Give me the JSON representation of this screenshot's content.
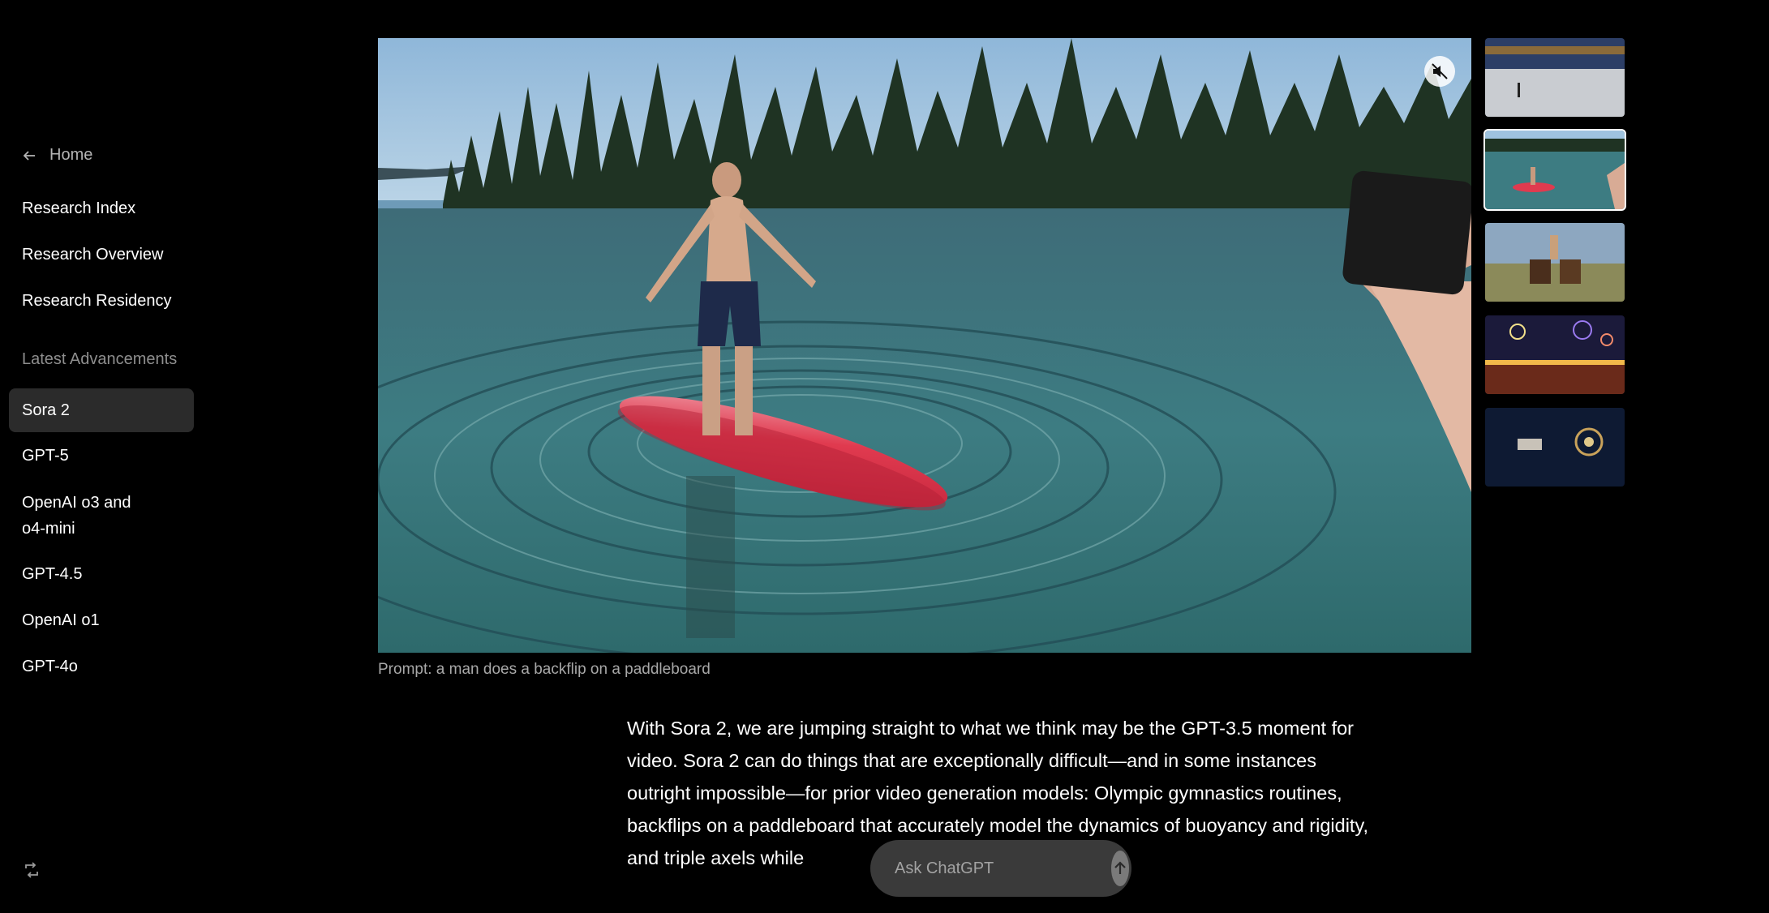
{
  "sidebar": {
    "home_label": "Home",
    "top_items": [
      {
        "label": "Research Index"
      },
      {
        "label": "Research Overview"
      },
      {
        "label": "Research Residency"
      }
    ],
    "section_label": "Latest Advancements",
    "section_items": [
      {
        "label": "Sora 2",
        "active": true
      },
      {
        "label": "GPT-5"
      },
      {
        "label": "OpenAI o3 and o4-mini"
      },
      {
        "label": "GPT-4.5"
      },
      {
        "label": "OpenAI o1"
      },
      {
        "label": "GPT-4o"
      }
    ],
    "footer_icon": "refresh-icon"
  },
  "video": {
    "caption": "Prompt: a man does a backflip on a paddleboard",
    "mute_icon": "muted-speaker-icon"
  },
  "thumbnails": [
    {
      "name": "ice-rink-skater"
    },
    {
      "name": "paddleboard-lake"
    },
    {
      "name": "horses-rider"
    },
    {
      "name": "fireworks-street"
    },
    {
      "name": "space-scene"
    }
  ],
  "article": {
    "paragraph": "With Sora 2, we are jumping straight to what we think may be the GPT-3.5 moment for video. Sora 2 can do things that are exceptionally difficult—and in some instances outright impossible—for prior video generation models: Olympic gymnastics routines, backflips on a paddleboard that accurately model the dynamics of buoyancy and rigidity, and triple axels while"
  },
  "ask_bar": {
    "placeholder": "Ask ChatGPT",
    "send_icon": "arrow-up-icon"
  },
  "colors": {
    "background": "#000000",
    "active_item": "#2b2b2b",
    "muted_text": "#8e8e8e",
    "ask_bar": "#3a3a3a"
  }
}
